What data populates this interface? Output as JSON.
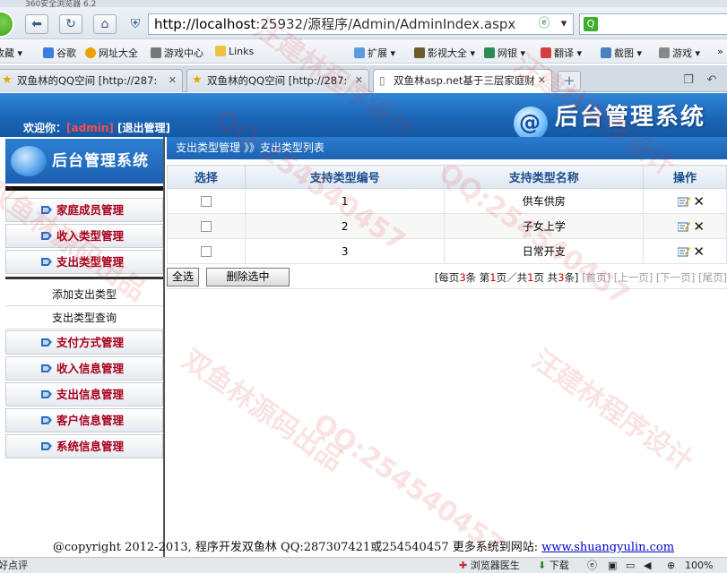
{
  "browser": {
    "title": "360安全浏览器 6.2",
    "address_host": "http://localhost",
    "address_rest": ":25932/源程序/Admin/AdminIndex.aspx",
    "bookmarks": [
      "收藏",
      "谷歌",
      "网址大全",
      "游戏中心",
      "Links",
      "扩展",
      "影视大全",
      "网银",
      "翻译",
      "截图",
      "游戏"
    ],
    "tabs": [
      {
        "label": "双鱼林的QQ空间 [http://287:"
      },
      {
        "label": "双鱼林的QQ空间 [http://287:"
      },
      {
        "label": "双鱼林asp.net基于三层家庭财"
      }
    ]
  },
  "header": {
    "welcome_prefix": "欢迎你：",
    "username": "[admin]",
    "logout": "[退出管理]",
    "brand": "后台管理系统"
  },
  "sidebar": {
    "brand": "后台管理系统",
    "menu_top": [
      "家庭成员管理",
      "收入类型管理",
      "支出类型管理"
    ],
    "sub_items": [
      "添加支出类型",
      "支出类型查询"
    ],
    "menu_bottom": [
      "支付方式管理",
      "收入信息管理",
      "支出信息管理",
      "客户信息管理",
      "系统信息管理"
    ]
  },
  "main": {
    "breadcrumb": "支出类型管理  》》支出类型列表",
    "columns": [
      "选择",
      "支持类型编号",
      "支持类型名称",
      "操作"
    ],
    "rows": [
      {
        "id": "1",
        "name": "供车供房"
      },
      {
        "id": "2",
        "name": "子女上学"
      },
      {
        "id": "3",
        "name": "日常开支"
      }
    ],
    "select_all": "全选",
    "delete_selected": "删除选中",
    "pager": {
      "p1": "[每页",
      "per_page": "3",
      "p2": "条 第",
      "current": "1",
      "p3": "页／共",
      "total_pages": "1",
      "p4": "页 共",
      "total": "3",
      "p5": "条]",
      "first": "[首页]",
      "prev": "[上一页]",
      "next": "[下一页]",
      "last": "[尾页]"
    }
  },
  "footer": {
    "text": "@copyright 2012-2013, 程序开发双鱼林  QQ:287307421或254540457  更多系统到网站: ",
    "link": "www.shuangyulin.com"
  },
  "statusbar": {
    "left": "好点评",
    "items": [
      "浏览器医生",
      "下载",
      "100%"
    ]
  },
  "watermarks": [
    "汪建林程序设计",
    "QQ:254540457",
    "双鱼林源码出品",
    "QQ:254540457",
    "汪建林程序设计",
    "双鱼林源码出品",
    "QQ:254540457",
    "汪建林程序设计"
  ],
  "colors": {
    "header_blue": "#1a64b5",
    "menu_text": "#a8001c",
    "pager_number": "#d40000"
  }
}
